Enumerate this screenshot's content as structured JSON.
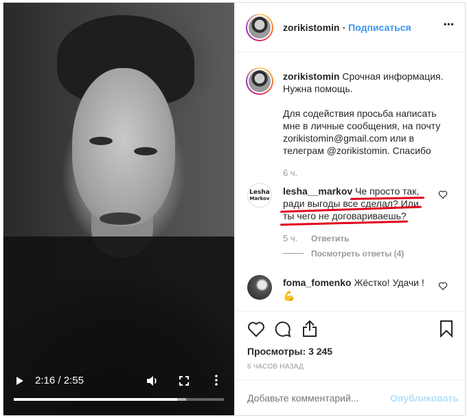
{
  "video": {
    "time_current": "2:16",
    "time_total": "2:55",
    "time_separator": "/",
    "progress": 0.777,
    "buffered": 0.82,
    "icons": [
      "play-icon",
      "volume-icon",
      "fullscreen-icon",
      "more-vertical-icon"
    ]
  },
  "header": {
    "username": "zorikistomin",
    "dot": "•",
    "follow_label": "Подписаться",
    "more_label": "•••"
  },
  "caption": {
    "username": "zorikistomin",
    "line1": "Срочная информация.",
    "line2": "Нужна помощь.",
    "para2_line1": "Для содействия просьба написать",
    "para2_line2": "мне в личные сообщения, на почту",
    "para2_line3": "zorikistomin@gmail.com или в",
    "para2_line4": "телеграм @zorikistomin. Спасибо",
    "time": "6 ч."
  },
  "comments": [
    {
      "username": "lesha__markov",
      "avatar_text_1": "Lesha",
      "avatar_text_2": "Markov",
      "line1": "Че просто так,",
      "line2": "ради выгоды все сделал? Или",
      "line3": "ты чего не договариваешь?",
      "time": "5 ч.",
      "reply_label": "Ответить",
      "view_replies_label": "Посмотреть ответы (4)"
    },
    {
      "username": "foma_fomenko",
      "text": "Жёстко! Удачи !",
      "emoji": "💪"
    }
  ],
  "actions": {
    "views_label": "Просмотры:",
    "views_count": "3 245",
    "timestamp": "6 ЧАСОВ НАЗАД"
  },
  "add_comment": {
    "placeholder": "Добавьте комментарий...",
    "publish_label": "Опубликовать"
  },
  "colors": {
    "link": "#3897f0",
    "underline_annotation": "#e0001b",
    "muted": "#999999",
    "text": "#262626"
  }
}
